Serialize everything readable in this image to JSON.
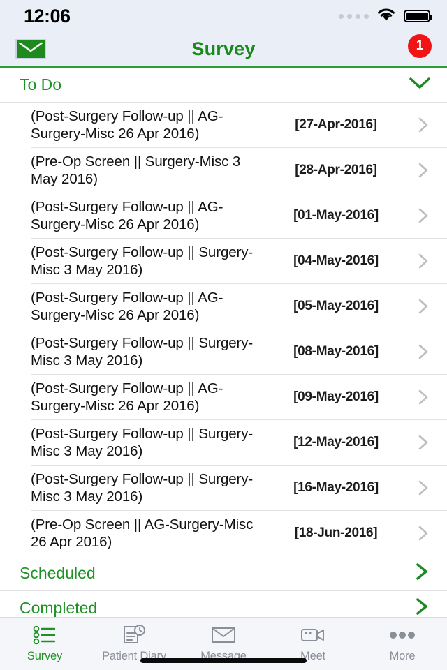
{
  "status_bar": {
    "time": "12:06",
    "signal_dots": 4,
    "wifi_icon": "wifi-icon",
    "battery_icon": "battery-full-icon"
  },
  "nav_bar": {
    "title": "Survey",
    "mail_icon": "envelope-icon",
    "bell_icon": "bell-icon",
    "notification_count": "1",
    "accent_color": "#1a8a1a",
    "badge_color": "#f01414"
  },
  "sections": [
    {
      "id": "todo",
      "label": "To Do",
      "expanded": true,
      "chevron_icon": "chevron-down-icon"
    },
    {
      "id": "scheduled",
      "label": "Scheduled",
      "expanded": false,
      "chevron_icon": "chevron-right-icon"
    },
    {
      "id": "completed",
      "label": "Completed",
      "expanded": false,
      "chevron_icon": "chevron-right-icon"
    }
  ],
  "todo_items": [
    {
      "title": "(Post-Surgery Follow-up || AG-Surgery-Misc 26 Apr 2016)",
      "date": "[27-Apr-2016]"
    },
    {
      "title": "(Pre-Op Screen || Surgery-Misc 3 May 2016)",
      "date": "[28-Apr-2016]"
    },
    {
      "title": "(Post-Surgery Follow-up || AG-Surgery-Misc 26 Apr 2016)",
      "date": "[01-May-2016]"
    },
    {
      "title": "(Post-Surgery Follow-up || Surgery-Misc 3 May 2016)",
      "date": "[04-May-2016]"
    },
    {
      "title": "(Post-Surgery Follow-up || AG-Surgery-Misc 26 Apr 2016)",
      "date": "[05-May-2016]"
    },
    {
      "title": "(Post-Surgery Follow-up || Surgery-Misc 3 May 2016)",
      "date": "[08-May-2016]"
    },
    {
      "title": "(Post-Surgery Follow-up || AG-Surgery-Misc 26 Apr 2016)",
      "date": "[09-May-2016]"
    },
    {
      "title": "(Post-Surgery Follow-up || Surgery-Misc 3 May 2016)",
      "date": "[12-May-2016]"
    },
    {
      "title": "(Post-Surgery Follow-up || Surgery-Misc 3 May 2016)",
      "date": "[16-May-2016]"
    },
    {
      "title": "(Pre-Op Screen || AG-Surgery-Misc 26 Apr 2016)",
      "date": "[18-Jun-2016]"
    }
  ],
  "tab_bar": {
    "tabs": [
      {
        "id": "survey",
        "label": "Survey",
        "icon": "checklist-icon",
        "active": true
      },
      {
        "id": "diary",
        "label": "Patient Diary",
        "icon": "document-clock-icon",
        "active": false
      },
      {
        "id": "message",
        "label": "Message",
        "icon": "envelope-icon",
        "active": false
      },
      {
        "id": "meet",
        "label": "Meet",
        "icon": "video-camera-icon",
        "active": false
      },
      {
        "id": "more",
        "label": "More",
        "icon": "ellipsis-icon",
        "active": false
      }
    ],
    "active_color": "#1f9125",
    "inactive_color": "#8b8f98"
  }
}
